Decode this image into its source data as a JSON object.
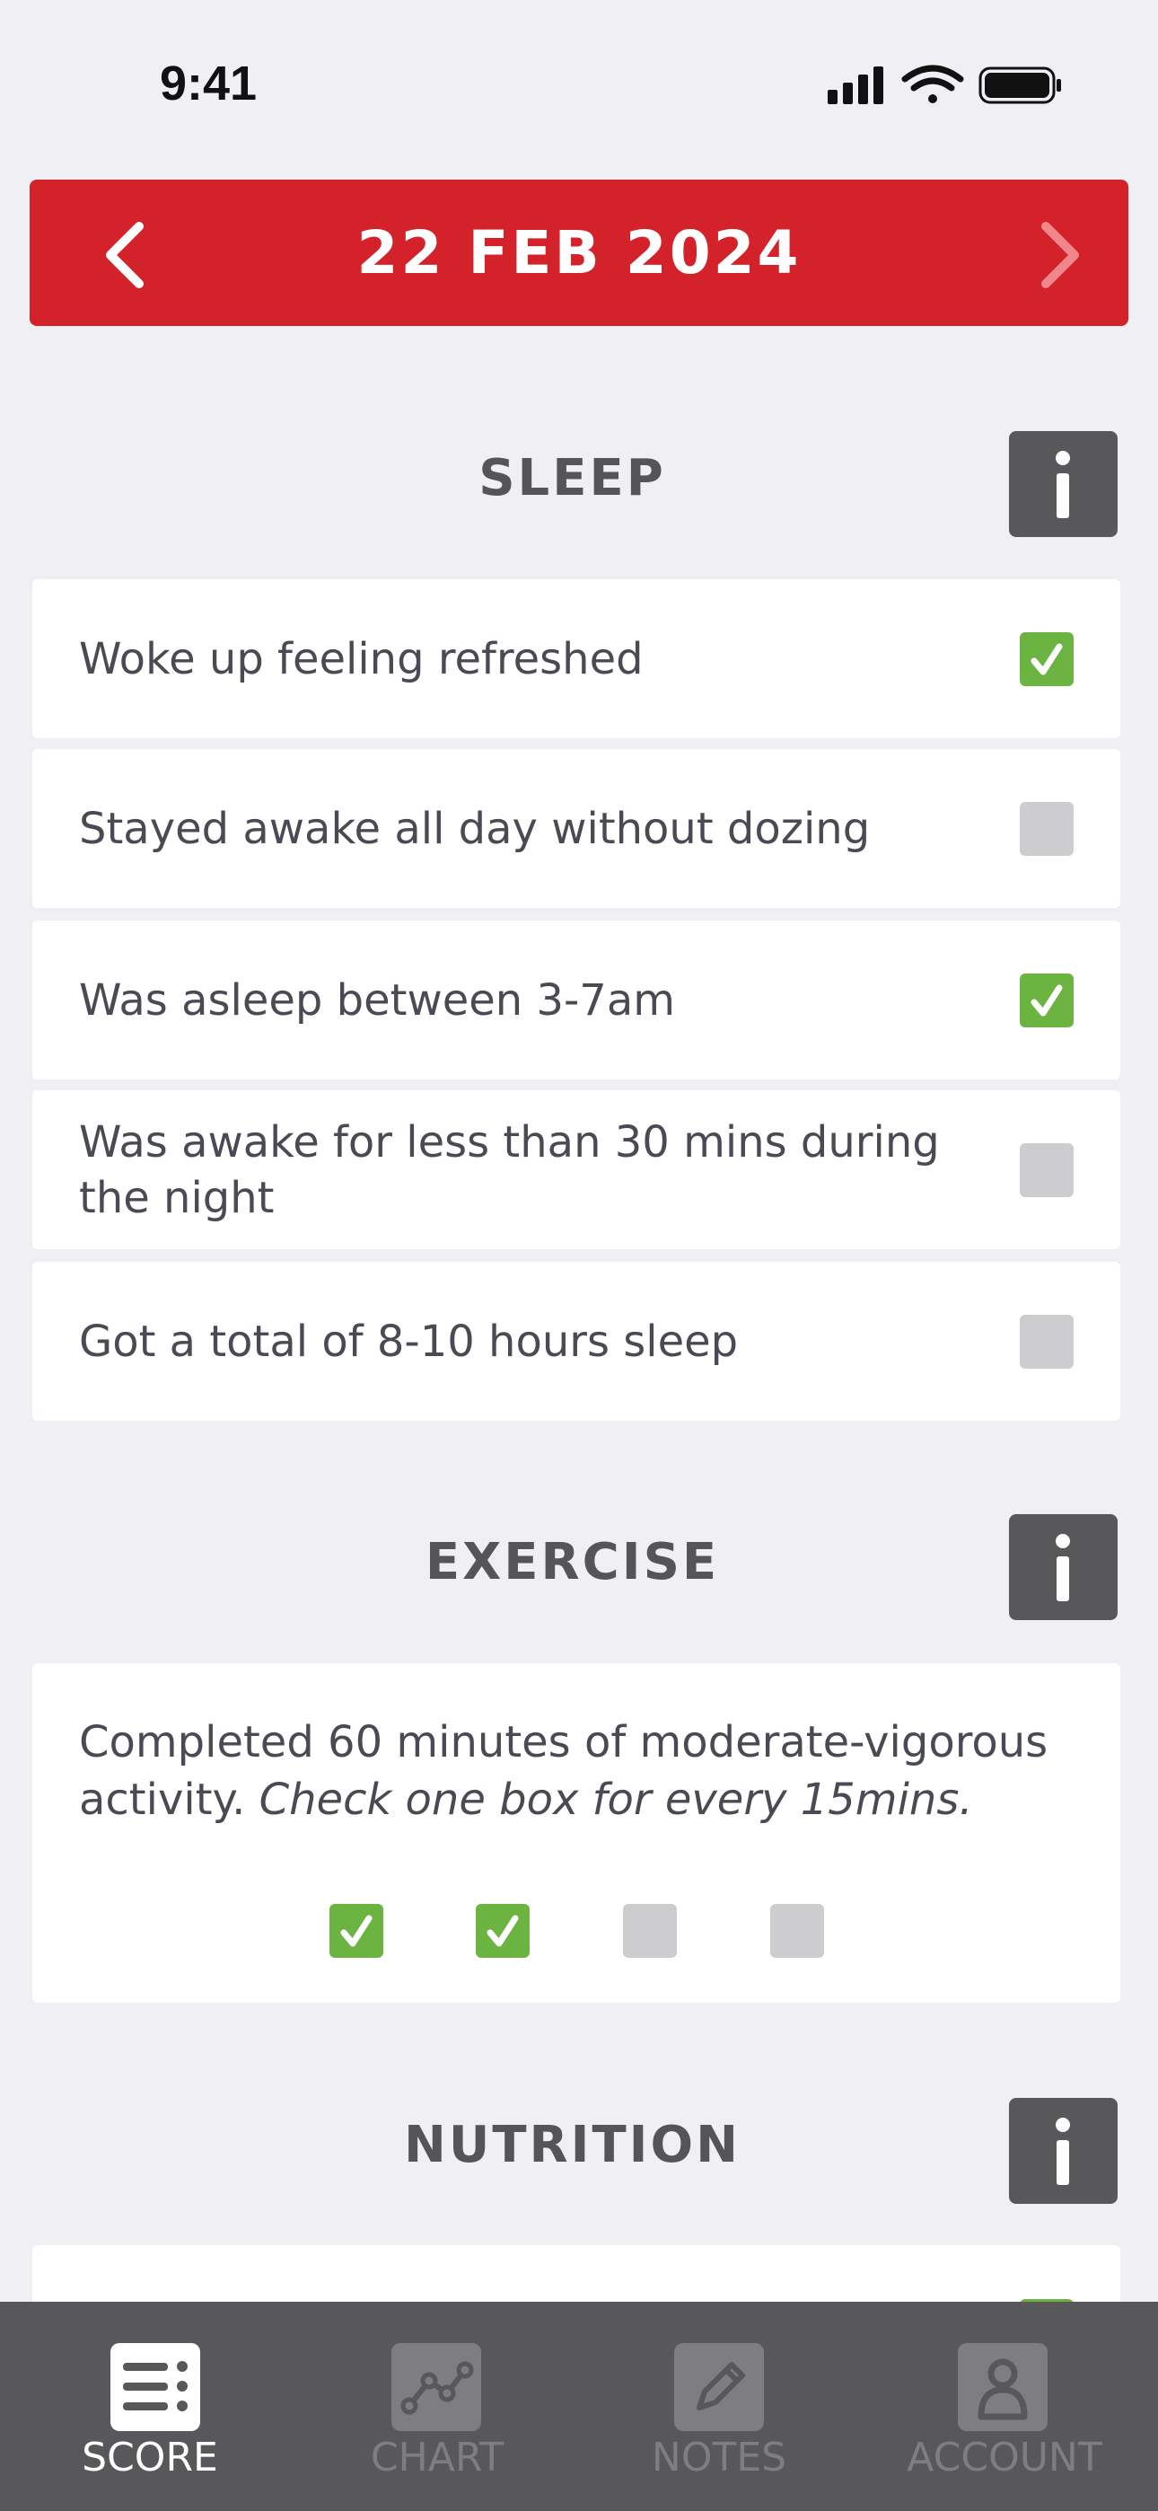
{
  "status_bar": {
    "time": "9:41"
  },
  "header": {
    "date": "22 FEB 2024",
    "accent_color": "#d3222a"
  },
  "sections": {
    "sleep": {
      "title": "SLEEP",
      "items": [
        {
          "label": "Woke up feeling refreshed",
          "checked": true
        },
        {
          "label": "Stayed awake all day without dozing",
          "checked": false
        },
        {
          "label": "Was asleep between 3-7am",
          "checked": true
        },
        {
          "label": "Was awake for less than 30 mins during the night",
          "checked": false
        },
        {
          "label": "Got a total of 8-10 hours sleep",
          "checked": false
        }
      ]
    },
    "exercise": {
      "title": "EXERCISE",
      "text_main": "Completed 60 minutes of moderate-vigorous activity.",
      "text_hint": "Check one box for every 15mins.",
      "boxes": [
        true,
        true,
        false,
        false
      ]
    },
    "nutrition": {
      "title": "NUTRITION"
    }
  },
  "colors": {
    "checked": "#6cb442",
    "unchecked": "#cdcdcf",
    "info_button": "#58585b"
  },
  "tabs": [
    {
      "label": "SCORE",
      "icon": "list-icon",
      "active": true
    },
    {
      "label": "CHART",
      "icon": "chart-icon",
      "active": false
    },
    {
      "label": "NOTES",
      "icon": "pencil-icon",
      "active": false
    },
    {
      "label": "ACCOUNT",
      "icon": "account-icon",
      "active": false
    }
  ]
}
